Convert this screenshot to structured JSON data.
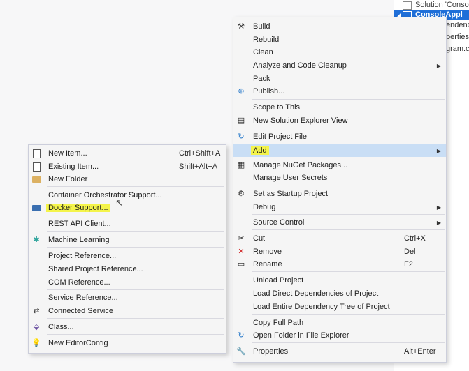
{
  "solution_explorer": {
    "rows": [
      {
        "label": "Solution 'Console",
        "selected": false
      },
      {
        "label": "ConsoleAppl",
        "selected": true
      },
      {
        "label": "endenc",
        "selected": false
      },
      {
        "label": "perties",
        "selected": false
      },
      {
        "label": "gram.c",
        "selected": false
      }
    ]
  },
  "main_menu": {
    "build": "Build",
    "rebuild": "Rebuild",
    "clean": "Clean",
    "analyze": "Analyze and Code Cleanup",
    "pack": "Pack",
    "publish": "Publish...",
    "scope": "Scope to This",
    "new_view": "New Solution Explorer View",
    "edit_project": "Edit Project File",
    "add": "Add",
    "nuget": "Manage NuGet Packages...",
    "user_secrets": "Manage User Secrets",
    "startup": "Set as Startup Project",
    "debug": "Debug",
    "source_control": "Source Control",
    "cut": "Cut",
    "cut_shortcut": "Ctrl+X",
    "remove": "Remove",
    "remove_shortcut": "Del",
    "rename": "Rename",
    "rename_shortcut": "F2",
    "unload": "Unload Project",
    "load_direct": "Load Direct Dependencies of Project",
    "load_tree": "Load Entire Dependency Tree of Project",
    "copy_path": "Copy Full Path",
    "open_folder": "Open Folder in File Explorer",
    "properties": "Properties",
    "properties_shortcut": "Alt+Enter"
  },
  "add_submenu": {
    "new_item": "New Item...",
    "new_item_shortcut": "Ctrl+Shift+A",
    "existing_item": "Existing Item...",
    "existing_item_shortcut": "Shift+Alt+A",
    "new_folder": "New Folder",
    "container": "Container Orchestrator Support...",
    "docker": "Docker Support...",
    "rest_api": "REST API Client...",
    "ml": "Machine Learning",
    "project_ref": "Project Reference...",
    "shared_ref": "Shared Project Reference...",
    "com_ref": "COM Reference...",
    "service_ref": "Service Reference...",
    "connected": "Connected Service",
    "class": "Class...",
    "editorconfig": "New EditorConfig"
  },
  "colors": {
    "highlight_yellow": "#f4f44a",
    "selection_blue": "#1f6fd8",
    "hover_blue": "#c9def5"
  }
}
